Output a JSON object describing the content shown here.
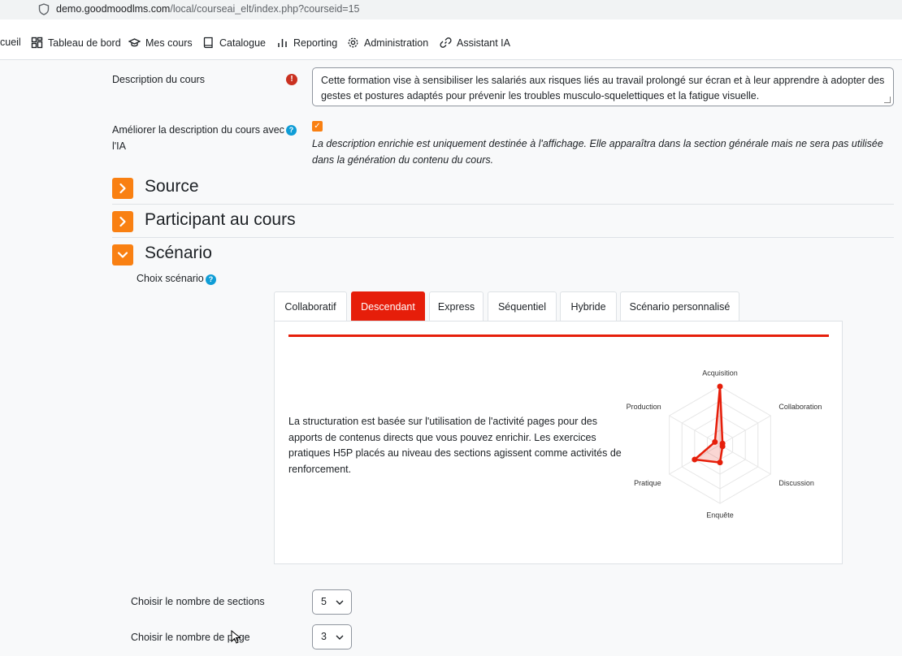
{
  "browser": {
    "url_domain": "demo.goodmoodlms.com",
    "url_path": "/local/courseai_elt/index.php?courseid=15"
  },
  "nav": {
    "items": [
      {
        "label": "cueil",
        "icon": "none"
      },
      {
        "label": "Tableau de bord",
        "icon": "dashboard-icon"
      },
      {
        "label": "Mes cours",
        "icon": "graduation-cap-icon"
      },
      {
        "label": "Catalogue",
        "icon": "book-icon"
      },
      {
        "label": "Reporting",
        "icon": "bar-chart-icon"
      },
      {
        "label": "Administration",
        "icon": "gear-icon"
      },
      {
        "label": "Assistant IA",
        "icon": "link-icon"
      }
    ]
  },
  "form": {
    "description_label": "Description du cours",
    "required_icon": "!",
    "description_value": "Cette formation vise à sensibiliser les salariés aux risques liés au travail prolongé sur écran et à leur apprendre à adopter des gestes et postures adaptés pour prévenir les troubles musculo-squelettiques et la fatigue visuelle.",
    "improve_label": "Améliorer la description du cours avec l'IA",
    "improve_checked": true,
    "improve_hint": "La description enrichie est uniquement destinée à l'affichage. Elle apparaîtra dans la section générale mais ne sera pas utilisée dans la génération du contenu du cours.",
    "help_icon": "?",
    "check_mark": "✓"
  },
  "sections": [
    {
      "title": "Source",
      "expanded": false
    },
    {
      "title": "Participant au cours",
      "expanded": false
    },
    {
      "title": "Scénario",
      "expanded": true
    }
  ],
  "scenario": {
    "choice_label": "Choix scénario",
    "tabs": [
      "Collaboratif",
      "Descendant",
      "Express",
      "Séquentiel",
      "Hybride",
      "Scénario personnalisé"
    ],
    "active_tab": "Descendant",
    "accent_color": "#e61e0a",
    "description": "La structuration est basée sur l'utilisation de l'activité pages pour des apports de contenus directs que vous pouvez enrichir. Les exercices pratiques H5P placés au niveau des sections agissent comme activités de renforcement.",
    "radar": {
      "axes": [
        "Acquisition",
        "Collaboration",
        "Discussion",
        "Enquête",
        "Pratique",
        "Production"
      ],
      "values": [
        1.0,
        0.05,
        0.05,
        0.3,
        0.5,
        0.1
      ],
      "max": 1,
      "rings": 4
    }
  },
  "settings": {
    "sections_label": "Choisir le nombre de sections",
    "sections_value": "5",
    "pages_label": "Choisir le nombre de page",
    "pages_value": "3"
  },
  "colors": {
    "brand_orange": "#f98012",
    "required_red": "#ca3120",
    "help_blue": "#0f9dd6"
  }
}
